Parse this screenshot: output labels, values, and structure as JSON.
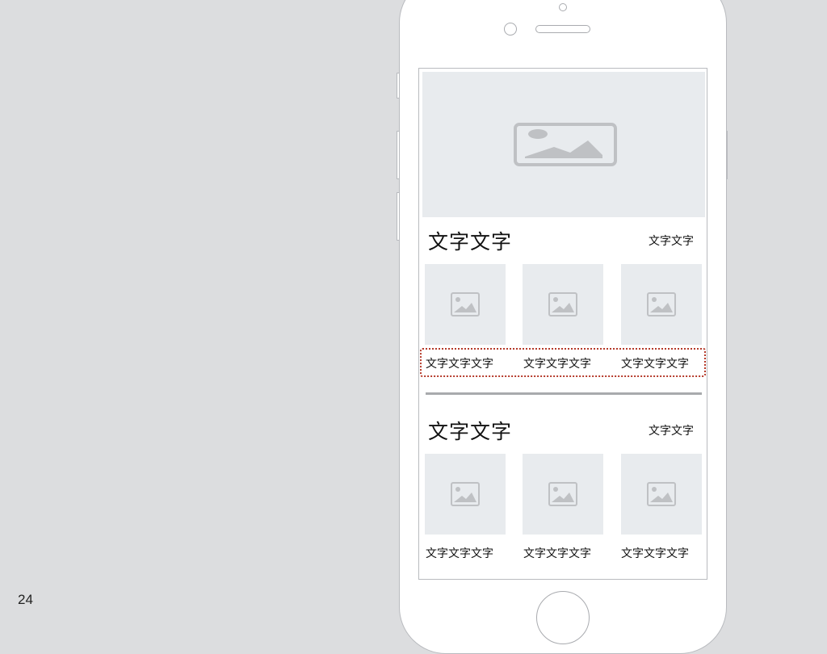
{
  "page_number": "24",
  "sections": [
    {
      "title": "文字文字",
      "more": "文字文字",
      "items": [
        {
          "caption": "文字文字文字"
        },
        {
          "caption": "文字文字文字"
        },
        {
          "caption": "文字文字文字"
        }
      ]
    },
    {
      "title": "文字文字",
      "more": "文字文字",
      "items": [
        {
          "caption": "文字文字文字"
        },
        {
          "caption": "文字文字文字"
        },
        {
          "caption": "文字文字文字"
        }
      ]
    }
  ],
  "icons": {
    "placeholder": "image-placeholder-icon",
    "home": "home-button"
  },
  "colors": {
    "background": "#dcdddf",
    "placeholder_fill": "#e8ebee",
    "placeholder_icon": "#bfc1c4",
    "highlight": "#b53a2a"
  }
}
